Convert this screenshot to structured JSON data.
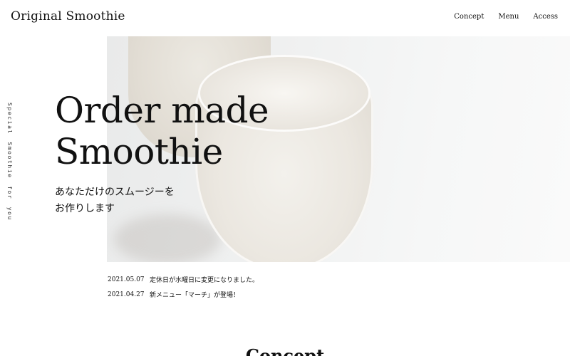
{
  "header": {
    "site_title": "Original Smoothie",
    "nav": [
      {
        "label": "Concept"
      },
      {
        "label": "Menu"
      },
      {
        "label": "Access"
      }
    ]
  },
  "side": {
    "tagline": "Special Smoothie for you"
  },
  "hero": {
    "heading_line1": "Order made",
    "heading_line2": "Smoothie",
    "sub_line1": "あなただけのスムージーを",
    "sub_line2": "お作りします",
    "image_icon": "smoothie-glass-photo"
  },
  "news": [
    {
      "date": "2021.05.07",
      "text": "定休日が水曜日に変更になりました。"
    },
    {
      "date": "2021.04.27",
      "text": "新メニュー「マーチ」が登場！"
    }
  ],
  "sections": {
    "concept_title": "Concept"
  }
}
